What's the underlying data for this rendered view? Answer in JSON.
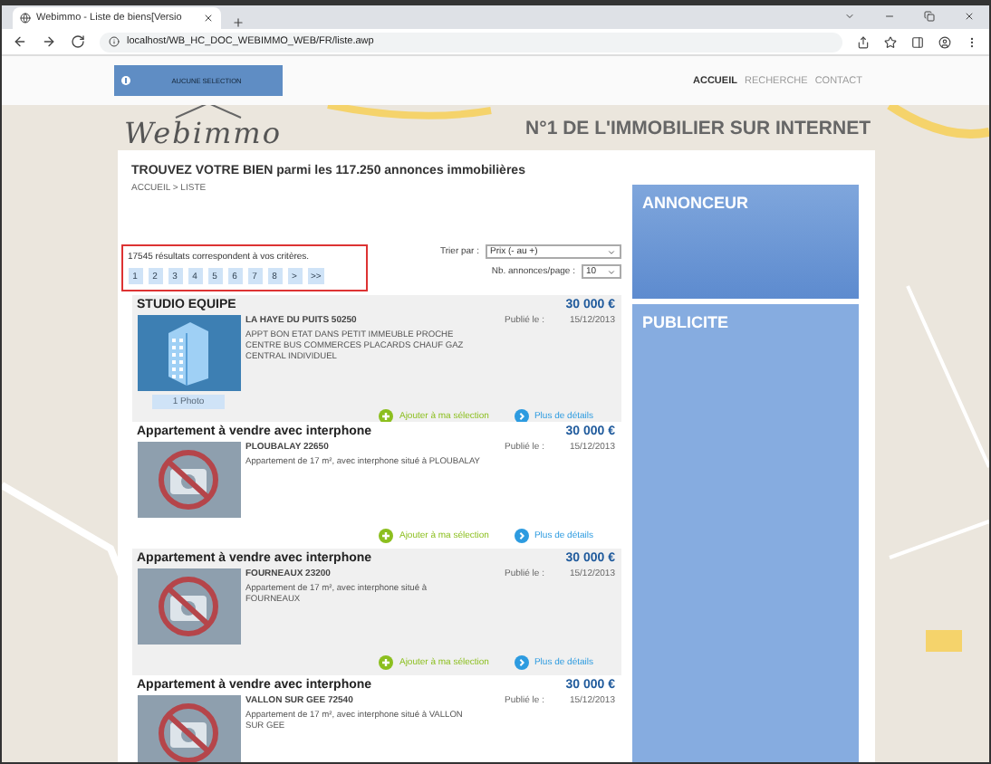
{
  "browser": {
    "tab_title": "Webimmo - Liste de biens[Versio",
    "url": "localhost/WB_HC_DOC_WEBIMMO_WEB/FR/liste.awp"
  },
  "header": {
    "selection_button": "AUCUNE SELECTION",
    "nav": [
      {
        "label": "ACCUEIL",
        "selected": true
      },
      {
        "label": "RECHERCHE",
        "selected": false
      },
      {
        "label": "CONTACT",
        "selected": false
      }
    ]
  },
  "banner": {
    "logo": "Webimmo",
    "tagline": "N°1 DE L'IMMOBILIER SUR INTERNET"
  },
  "page": {
    "title": "TROUVEZ VOTRE BIEN parmi les 117.250 annonces immobilières",
    "breadcrumb": "ACCUEIL > LISTE",
    "results_count": "17545 résultats correspondent à vos critères.",
    "pages": [
      "1",
      "2",
      "3",
      "4",
      "5",
      "6",
      "7",
      "8",
      ">",
      ">>"
    ],
    "sort_label": "Trier par :",
    "sort_value": "Prix (- au +)",
    "per_page_label": "Nb. annonces/page :",
    "per_page_value": "10"
  },
  "listings": [
    {
      "title": "STUDIO EQUIPE",
      "price": "30 000 €",
      "city": "LA HAYE DU PUITS 50250",
      "published_label": "Publié le :",
      "date": "15/12/2013",
      "description": "APPT BON ETAT DANS PETIT IMMEUBLE PROCHE CENTRE BUS COMMERCES PLACARDS CHAUF GAZ CENTRAL INDIVIDUEL",
      "kind": "building",
      "photo_caption": "1 Photo",
      "add_label": "Ajouter à ma sélection",
      "details_label": "Plus de détails"
    },
    {
      "title": "Appartement à vendre avec interphone",
      "price": "30 000 €",
      "city": "PLOUBALAY 22650",
      "published_label": "Publié le :",
      "date": "15/12/2013",
      "description": "Appartement de 17 m², avec interphone situé à PLOUBALAY",
      "kind": "none",
      "add_label": "Ajouter à ma sélection",
      "details_label": "Plus de détails"
    },
    {
      "title": "Appartement à vendre avec interphone",
      "price": "30 000 €",
      "city": "FOURNEAUX 23200",
      "published_label": "Publié le :",
      "date": "15/12/2013",
      "description": "Appartement de 17 m², avec interphone situé à FOURNEAUX",
      "kind": "none",
      "add_label": "Ajouter à ma sélection",
      "details_label": "Plus de détails"
    },
    {
      "title": "Appartement à vendre avec interphone",
      "price": "30 000 €",
      "city": "VALLON SUR GEE 72540",
      "published_label": "Publié le :",
      "date": "15/12/2013",
      "description": "Appartement de 17 m², avec interphone situé à VALLON SUR GEE",
      "kind": "none"
    }
  ],
  "sidebar": [
    {
      "title": "ANNONCEUR",
      "kind": "advertiser"
    },
    {
      "title": "PUBLICITE",
      "kind": "ad"
    }
  ]
}
